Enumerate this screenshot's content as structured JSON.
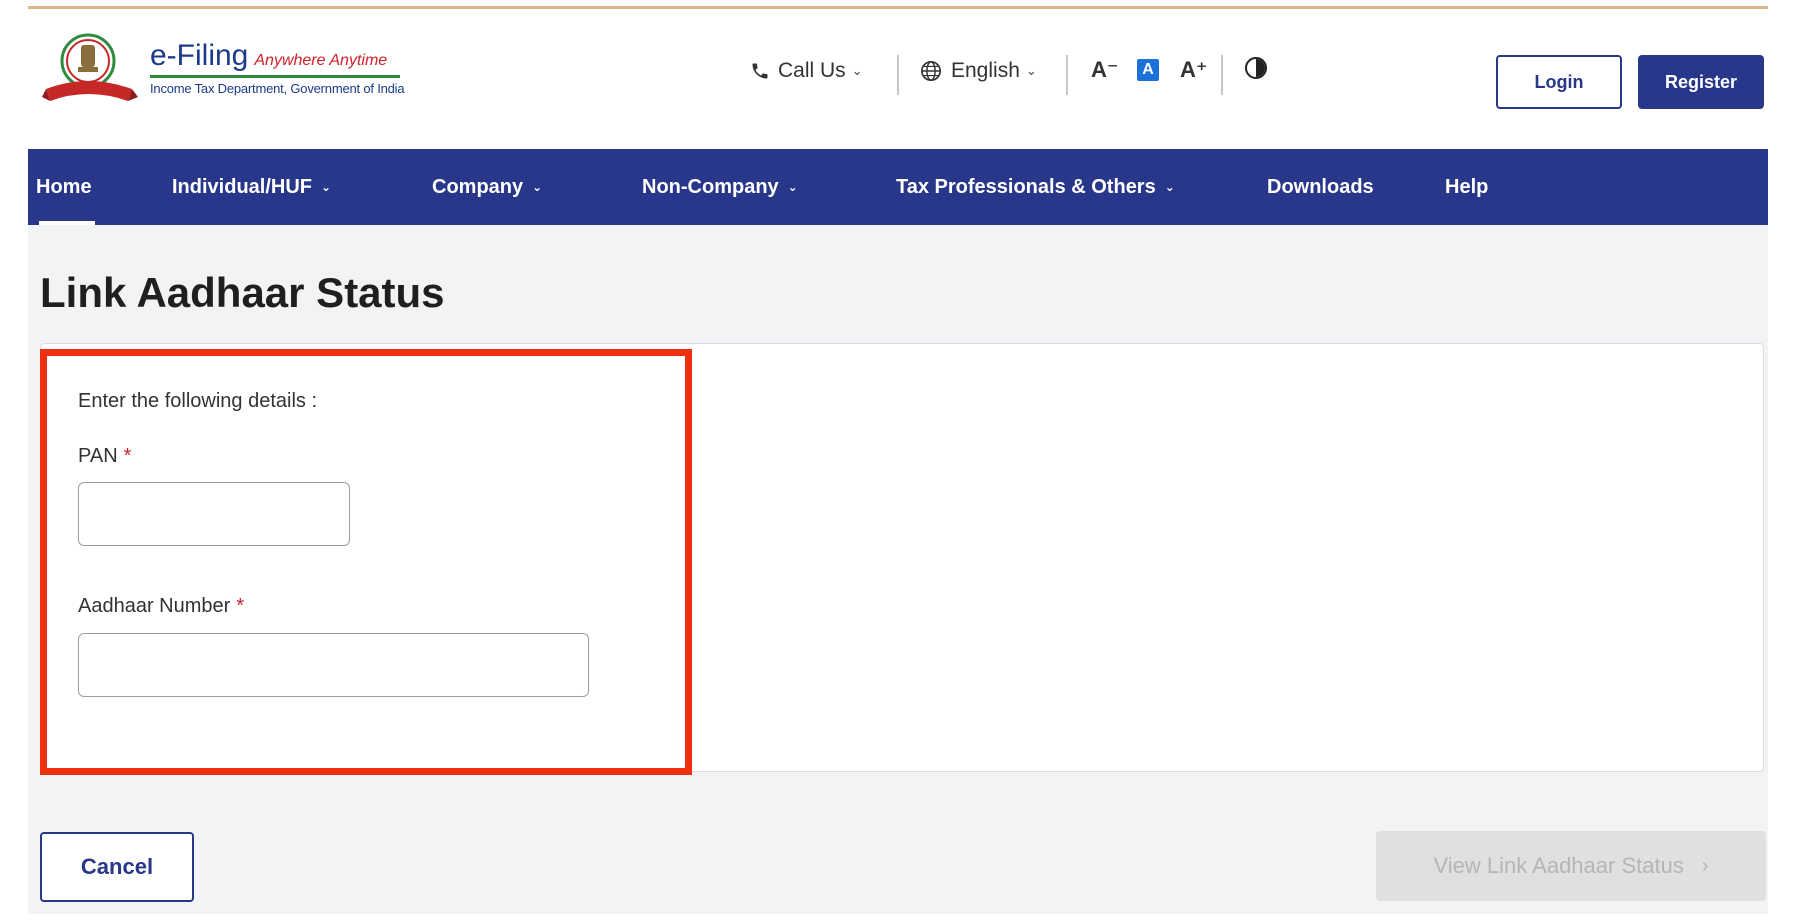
{
  "logo": {
    "name": "e-Filing",
    "tagline": "Anywhere Anytime",
    "subtitle": "Income Tax Department, Government of India"
  },
  "header": {
    "call_us": "Call Us",
    "language": "English",
    "font_decrease": "A⁻",
    "font_default": "A",
    "font_increase": "A⁺",
    "login": "Login",
    "register": "Register"
  },
  "nav": {
    "items": [
      {
        "label": "Home",
        "active": true,
        "dropdown": false
      },
      {
        "label": "Individual/HUF",
        "active": false,
        "dropdown": true
      },
      {
        "label": "Company",
        "active": false,
        "dropdown": true
      },
      {
        "label": "Non-Company",
        "active": false,
        "dropdown": true
      },
      {
        "label": "Tax Professionals & Others",
        "active": false,
        "dropdown": true
      },
      {
        "label": "Downloads",
        "active": false,
        "dropdown": false
      },
      {
        "label": "Help",
        "active": false,
        "dropdown": false
      }
    ]
  },
  "page": {
    "title": "Link Aadhaar Status",
    "intro": "Enter the following details :",
    "pan_label": "PAN",
    "pan_value": "",
    "aadhaar_label": "Aadhaar Number",
    "aadhaar_value": "",
    "required_marker": "*",
    "cancel": "Cancel",
    "view_status": "View Link Aadhaar Status"
  },
  "colors": {
    "brand_blue": "#29378b",
    "highlight_red": "#ee2f10",
    "required_red": "#d0202a",
    "disabled_gray": "#e0e0e0"
  }
}
